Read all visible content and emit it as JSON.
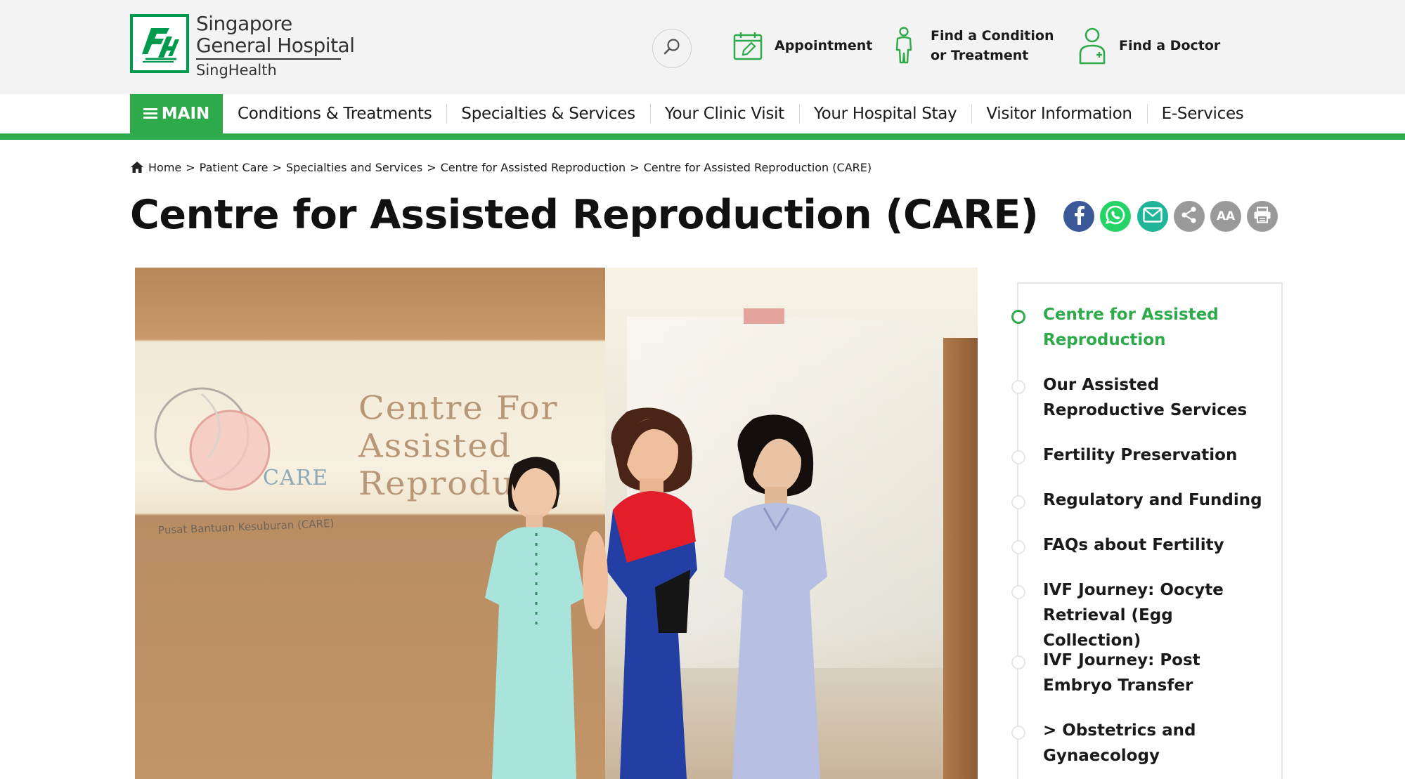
{
  "header": {
    "logo": {
      "line1": "Singapore",
      "line2": "General Hospital",
      "line3": "SingHealth"
    },
    "search_icon": "search-icon",
    "quick_links": [
      {
        "icon": "calendar-edit-icon",
        "line1": "Appointment",
        "line2": ""
      },
      {
        "icon": "person-icon",
        "line1": "Find a Condition",
        "line2": "or Treatment"
      },
      {
        "icon": "doctor-icon",
        "line1": "Find a Doctor",
        "line2": ""
      }
    ]
  },
  "nav": {
    "menu_label": "MAIN",
    "items": [
      "Conditions & Treatments",
      "Specialties & Services",
      "Your Clinic Visit",
      "Your Hospital Stay",
      "Visitor Information",
      "E-Services"
    ]
  },
  "breadcrumb": [
    "Home",
    "Patient Care",
    "Specialties and Services",
    "Centre for Assisted Reproduction",
    "Centre for Assisted Reproduction (CARE)"
  ],
  "page": {
    "title": "Centre for Assisted Reproduction (CARE)"
  },
  "share": {
    "icons": [
      "facebook-icon",
      "whatsapp-icon",
      "email-icon",
      "share-icon",
      "font-size-icon",
      "print-icon"
    ],
    "font_size_label": "AA"
  },
  "hero": {
    "sign_line1": "Centre For",
    "sign_line2": "Assisted",
    "sign_line3": "Reproducti",
    "care_mark": "CARE",
    "sign_small": "Pusat Bantuan Kesuburan (CARE)"
  },
  "sidebar": {
    "items": [
      {
        "line1": "Centre for Assisted",
        "line2": "Reproduction",
        "active": true
      },
      {
        "line1": "Our Assisted",
        "line2": "Reproductive Services",
        "active": false
      },
      {
        "line1": "Fertility Preservation",
        "line2": "",
        "active": false
      },
      {
        "line1": "Regulatory and Funding",
        "line2": "",
        "active": false
      },
      {
        "line1": "FAQs about Fertility",
        "line2": "",
        "active": false
      },
      {
        "line1": "IVF Journey: Oocyte",
        "line2": "Retrieval (Egg Collection)",
        "active": false
      },
      {
        "line1": "IVF Journey: Post",
        "line2": "Embryo Transfer",
        "active": false
      },
      {
        "line1": "> Obstetrics and",
        "line2": "Gynaecology",
        "active": false
      }
    ]
  },
  "colors": {
    "brand_green": "#2eaa4a",
    "logo_green": "#009a4e",
    "header_bg": "#f3f3f3"
  }
}
